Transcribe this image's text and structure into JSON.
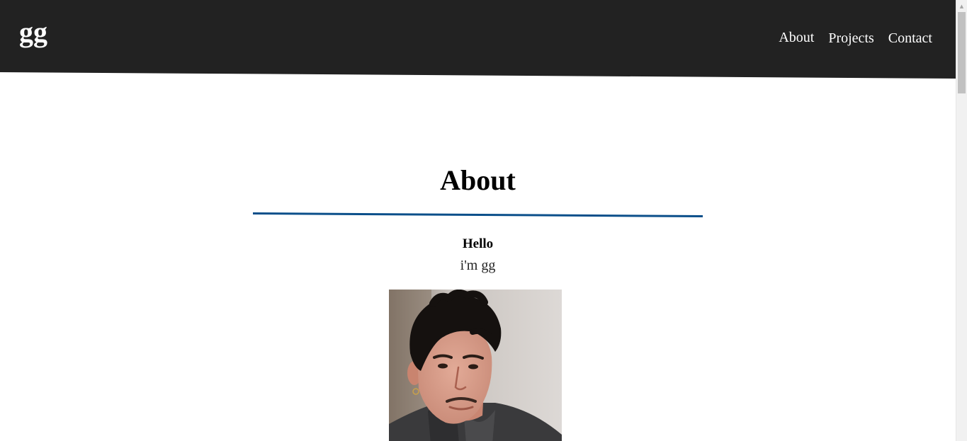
{
  "header": {
    "logo": "gg",
    "background": "#222222",
    "nav": [
      {
        "label": "About"
      },
      {
        "label": "Projects"
      },
      {
        "label": "Contact"
      }
    ]
  },
  "main": {
    "title": "About",
    "divider_color": "#0b4f8a",
    "greeting": "Hello",
    "intro": "i'm gg",
    "photo_icon": "profile-photo"
  },
  "scrollbar": {
    "up_icon": "arrow-up-icon"
  }
}
